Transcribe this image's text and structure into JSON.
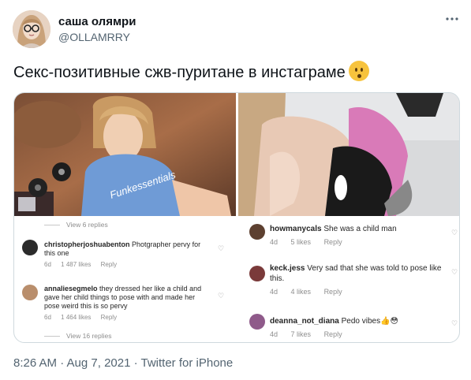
{
  "tweet": {
    "display_name": "саша олямри",
    "handle": "@OLLAMRRY",
    "more_icon": "more-icon",
    "text": "Секс-позитивные сжв-пуритане в инстаграме",
    "emoji": "hushed-face-emoji",
    "timestamp": "8:26 AM · Aug 7, 2021 · Twitter for iPhone"
  },
  "left_panel": {
    "view_replies_top": "View 6 replies",
    "comments": [
      {
        "username": "christopherjoshuabenton",
        "text": "Photgrapher pervy for this one",
        "age": "6d",
        "likes": "1 487 likes",
        "reply": "Reply"
      },
      {
        "username": "annaliesegmelo",
        "text": "they dressed her like a child and gave her child things to pose with and made her pose weird this is so pervy",
        "age": "6d",
        "likes": "1 464 likes",
        "reply": "Reply"
      }
    ],
    "view_replies_bottom": "View 16 replies",
    "shirt_text": "Funkessentials"
  },
  "right_panel": {
    "comments": [
      {
        "username": "howmanycals",
        "text": "She was a child man",
        "age": "4d",
        "likes": "5 likes",
        "reply": "Reply"
      },
      {
        "username": "keck.jess",
        "text": "Very sad that she was told to pose like this.",
        "age": "4d",
        "likes": "4 likes",
        "reply": "Reply"
      },
      {
        "username": "deanna_not_diana",
        "text": "Pedo vibes👍😳",
        "age": "4d",
        "likes": "7 likes",
        "reply": "Reply"
      }
    ]
  },
  "colors": {
    "text_primary": "#0f1419",
    "text_secondary": "#536471",
    "border": "#cfd9de",
    "shirt_blue": "#6f9bd6"
  }
}
